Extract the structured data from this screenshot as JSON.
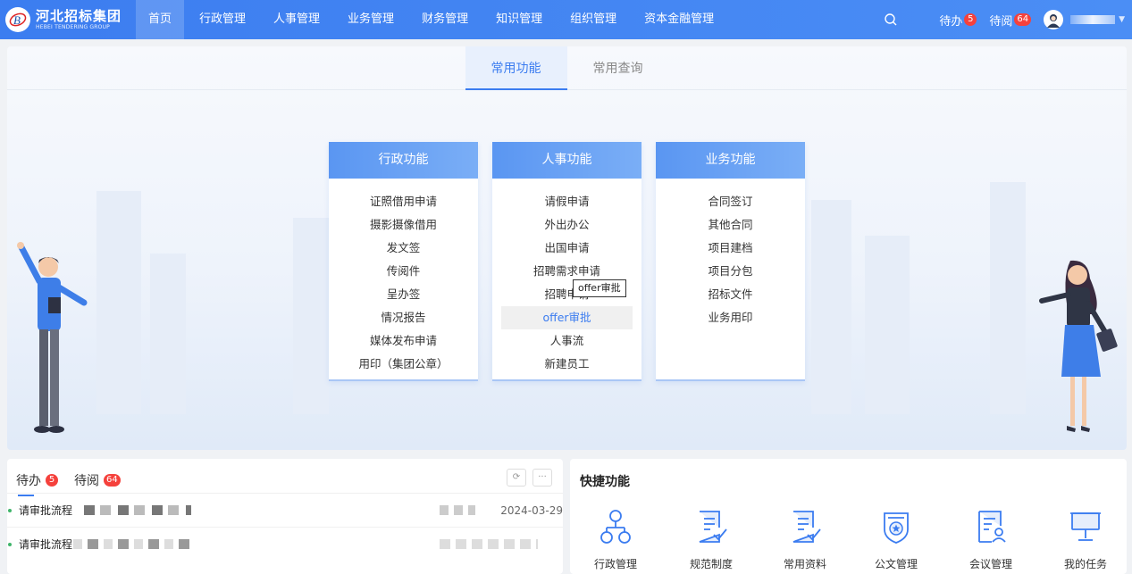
{
  "header": {
    "logo_cn": "河北招标集团",
    "logo_en": "HEBEI TENDERING GROUP",
    "nav": [
      "首页",
      "行政管理",
      "人事管理",
      "业务管理",
      "财务管理",
      "知识管理",
      "组织管理",
      "资本金融管理"
    ],
    "active_nav": "首页",
    "todo_label": "待办",
    "todo_count": "5",
    "toread_label": "待阅",
    "toread_count": "64",
    "icons": {
      "search": "search-icon",
      "avatar": "avatar-icon",
      "caret": "chevron-down-icon"
    }
  },
  "hero": {
    "tabs": [
      "常用功能",
      "常用查询"
    ],
    "active_tab": "常用功能",
    "cards": [
      {
        "title": "行政功能",
        "items": [
          "证照借用申请",
          "摄影摄像借用",
          "发文签",
          "传阅件",
          "呈办签",
          "情况报告",
          "媒体发布申请",
          "用印（集团公章）"
        ]
      },
      {
        "title": "人事功能",
        "items": [
          "请假申请",
          "外出办公",
          "出国申请",
          "招聘需求申请",
          "招聘申请",
          "offer审批",
          "人事流",
          "新建员工"
        ]
      },
      {
        "title": "业务功能",
        "items": [
          "合同签订",
          "其他合同",
          "项目建档",
          "项目分包",
          "招标文件",
          "业务用印"
        ]
      }
    ],
    "highlighted_item": "offer审批",
    "tooltip": "offer审批"
  },
  "todo_panel": {
    "tabs": [
      {
        "label": "待办",
        "count": "5"
      },
      {
        "label": "待阅",
        "count": "64"
      }
    ],
    "controls": [
      "refresh-icon",
      "more-icon"
    ],
    "rows": [
      {
        "title": "请审批流程",
        "date": "2024-03-29"
      },
      {
        "title": "请审批流程",
        "date": ""
      }
    ]
  },
  "quick_panel": {
    "title": "快捷功能",
    "items": [
      {
        "label": "行政管理",
        "icon": "org-chart-icon"
      },
      {
        "label": "规范制度",
        "icon": "document-check-icon"
      },
      {
        "label": "常用资料",
        "icon": "document-check-icon"
      },
      {
        "label": "公文管理",
        "icon": "shield-star-icon"
      },
      {
        "label": "会议管理",
        "icon": "document-person-icon"
      },
      {
        "label": "我的任务",
        "icon": "presentation-board-icon"
      }
    ]
  },
  "colors": {
    "primary": "#3b7cf0",
    "badge": "#f5413c",
    "card_head": "#5a96f2"
  }
}
